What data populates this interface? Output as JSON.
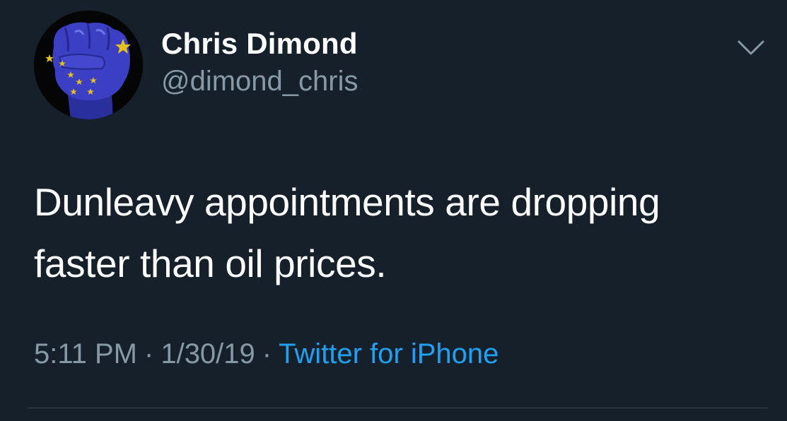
{
  "tweet": {
    "author": {
      "display_name": "Chris Dimond",
      "handle": "@dimond_chris",
      "avatar_icon": "raised-fist-alaska-flag-icon"
    },
    "text": "Dunleavy appointments are dropping faster than oil prices.",
    "meta": {
      "time": "5:11 PM",
      "separator": "·",
      "date": "1/30/19",
      "source": "Twitter for iPhone"
    },
    "menu_icon": "chevron-down-icon"
  },
  "colors": {
    "background": "#15202b",
    "primary_text": "#ffffff",
    "secondary_text": "#8899a6",
    "link": "#1da1f2",
    "divider": "#38444d",
    "flag_blue": "#3a3fc4",
    "flag_star": "#e8c21c"
  }
}
